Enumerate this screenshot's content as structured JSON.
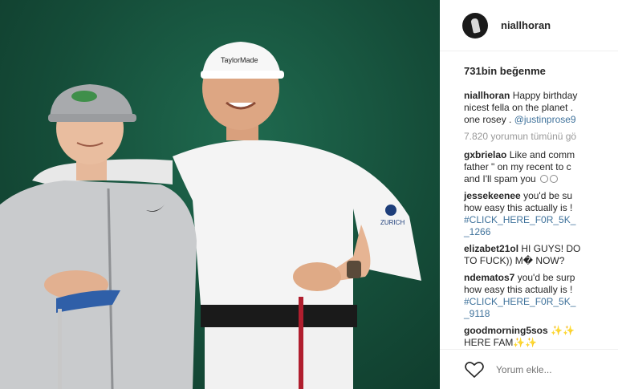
{
  "header": {
    "username": "niallhoran"
  },
  "likes": "731bin beğenme",
  "caption": {
    "username": "niallhoran",
    "lines": [
      "Happy birthday",
      "nicest fella on the planet .",
      "one rosey . "
    ],
    "mention": "@justinprose9"
  },
  "view_all": "7.820 yorumun tümünü gö",
  "comments": [
    {
      "username": "gxbrielao",
      "lines": [
        "Like and comm",
        "father \" on my recent to c",
        "and I'll spam you"
      ]
    },
    {
      "username": "jessekeenee",
      "lines": [
        "you'd be su",
        "how easy this actually is !",
        "#CLICK_HERE_F0R_5K_",
        "_1266"
      ]
    },
    {
      "username": "elizabet21ol",
      "lines": [
        "HI GUYS! DO",
        "TO FUCK)) M� NOW? "
      ]
    },
    {
      "username": "ndematos7",
      "lines": [
        "you'd be surp",
        "how easy this actually is !",
        "#CLICK_HERE_F0R_5K_",
        "_9118"
      ]
    },
    {
      "username": "goodmorning5sos",
      "lines": [
        "✨✨",
        "HERE FAM✨✨"
      ]
    }
  ],
  "footer": {
    "placeholder": "Yorum ekle..."
  },
  "icons": {
    "heart": "heart-icon",
    "avatar": "profile-avatar",
    "emoji": "smile-emoji-icon"
  },
  "colors": {
    "photo_bg": "#1a5a42",
    "mention": "#3f729b",
    "muted": "#999999"
  }
}
